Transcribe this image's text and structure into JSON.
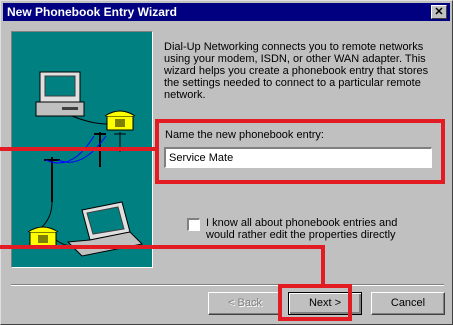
{
  "window": {
    "title": "New Phonebook Entry Wizard",
    "close_glyph": "✕"
  },
  "description": "Dial-Up Networking connects you to remote networks using your modem, ISDN, or other WAN adapter.  This wizard helps you create a phonebook entry that stores the settings needed to connect to a particular remote network.",
  "name_field": {
    "label": "Name the new phonebook entry:",
    "value": "Service Mate"
  },
  "checkbox": {
    "label": "I know all about phonebook entries and would rather edit the properties directly",
    "checked": false
  },
  "buttons": {
    "back": "< Back",
    "next": "Next >",
    "cancel": "Cancel"
  },
  "colors": {
    "titlebar": "#000080",
    "dialog": "#c0c0c0",
    "illustration_bg": "#008080",
    "highlight": "#e31b23"
  },
  "icons": [
    "computer-icon",
    "telephone-icon",
    "utility-pole-icon",
    "laptop-icon"
  ]
}
